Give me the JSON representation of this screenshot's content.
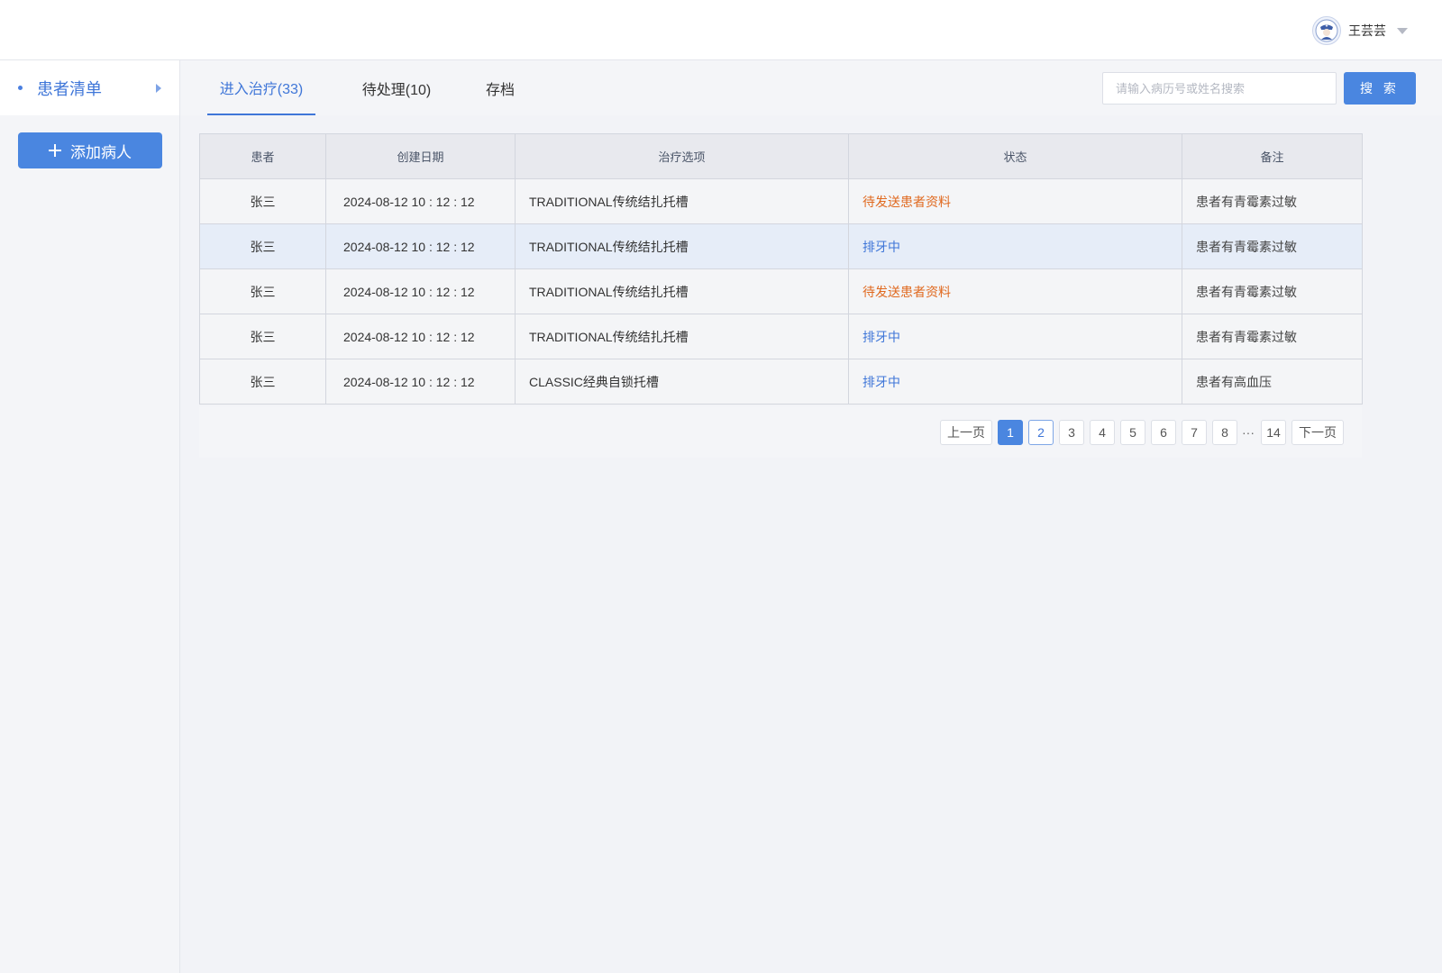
{
  "header": {
    "user_name": "王芸芸",
    "avatar_icon": "nurse-avatar-icon"
  },
  "sidebar": {
    "nav_label": "患者清单",
    "add_button_label": "添加病人"
  },
  "tabs": [
    {
      "label": "进入治疗(33)",
      "active": true
    },
    {
      "label": "待处理(10)",
      "active": false
    },
    {
      "label": "存档",
      "active": false
    }
  ],
  "search": {
    "placeholder": "请输入病历号或姓名搜索",
    "button_label": "搜 索"
  },
  "table": {
    "headers": [
      "患者",
      "创建日期",
      "治疗选项",
      "状态",
      "备注"
    ],
    "rows": [
      {
        "patient": "张三",
        "date": "2024-08-12 10 : 12 : 12",
        "treatment": "TRADITIONAL传统结扎托槽",
        "status": "待发送患者资料",
        "note": "患者有青霉素过敏"
      },
      {
        "patient": "张三",
        "date": "2024-08-12 10 : 12 : 12",
        "treatment": "TRADITIONAL传统结扎托槽",
        "status": "排牙中",
        "note": "患者有青霉素过敏"
      },
      {
        "patient": "张三",
        "date": "2024-08-12 10 : 12 : 12",
        "treatment": "TRADITIONAL传统结扎托槽",
        "status": "待发送患者资料",
        "note": "患者有青霉素过敏"
      },
      {
        "patient": "张三",
        "date": "2024-08-12 10 : 12 : 12",
        "treatment": "TRADITIONAL传统结扎托槽",
        "status": "排牙中",
        "note": "患者有青霉素过敏"
      },
      {
        "patient": "张三",
        "date": "2024-08-12 10 : 12 : 12",
        "treatment": "CLASSIC经典自锁托槽",
        "status": "排牙中",
        "note": "患者有高血压"
      }
    ]
  },
  "pagination": {
    "prev": "上一页",
    "next": "下一页",
    "pages": [
      "1",
      "2",
      "3",
      "4",
      "5",
      "6",
      "7",
      "8"
    ],
    "ellipsis": "···",
    "last": "14",
    "current": "1"
  },
  "colors": {
    "accent": "#4a86e0",
    "status_pending": "#e0691f",
    "status_in_progress": "#3f76d8"
  }
}
